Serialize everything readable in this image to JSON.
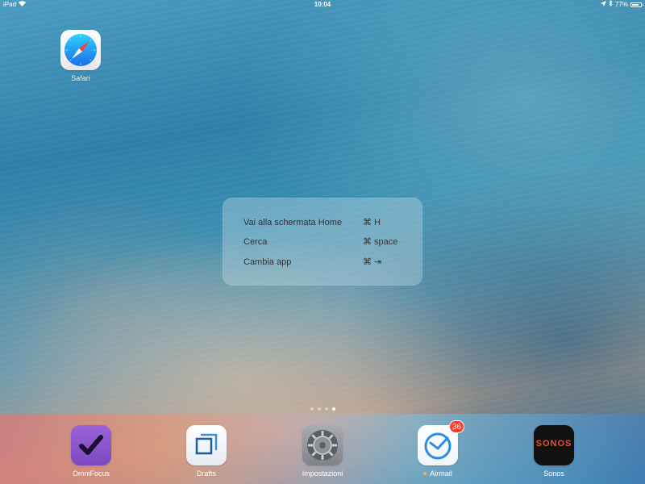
{
  "status_bar": {
    "device": "iPad",
    "time": "10:04",
    "battery_percent": "77%",
    "battery_level": 0.77
  },
  "home": {
    "apps": [
      {
        "label": "Safari",
        "icon": "safari-icon"
      }
    ]
  },
  "shortcuts_overlay": {
    "items": [
      {
        "label": "Vai alla schermata Home",
        "keys": "⌘  H"
      },
      {
        "label": "Cerca",
        "keys": "⌘  space"
      },
      {
        "label": "Cambia app",
        "keys": "⌘  ⇥"
      }
    ]
  },
  "page_indicator": {
    "pages": 4,
    "current": 4
  },
  "dock": {
    "apps": [
      {
        "label": "OmniFocus",
        "icon": "omnifocus-icon"
      },
      {
        "label": "Drafts",
        "icon": "drafts-icon"
      },
      {
        "label": "Impostazioni",
        "icon": "settings-gear-icon"
      },
      {
        "label": "Airmail",
        "icon": "airmail-icon",
        "badge": "36"
      },
      {
        "label": "Sonos",
        "icon": "sonos-icon",
        "icon_text": "SONOS"
      }
    ]
  },
  "colors": {
    "badge": "#ff3b30",
    "omnifocus": "#8b55cc",
    "sonos_text": "#e0513a",
    "airmail_blue": "#2a8ce8"
  }
}
